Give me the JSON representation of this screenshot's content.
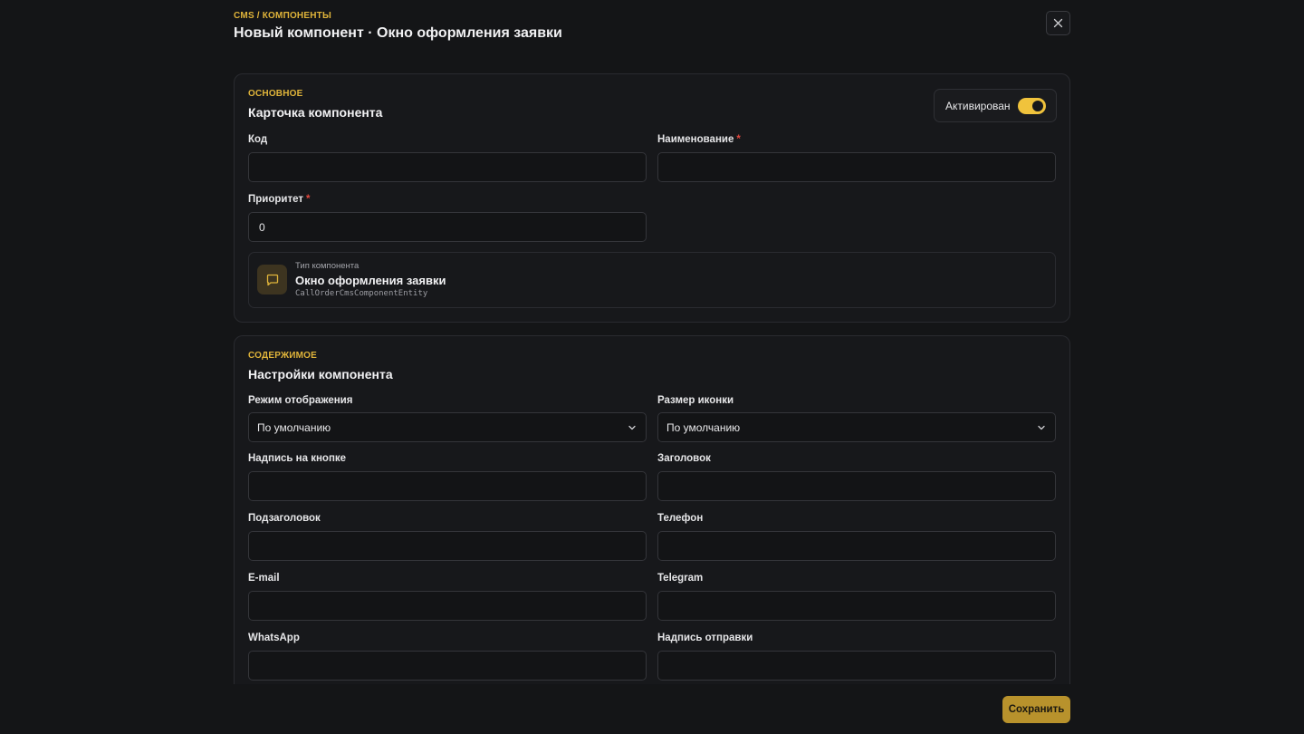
{
  "header": {
    "breadcrumb": "CMS / КОМПОНЕНТЫ",
    "title": "Новый компонент · Окно оформления заявки",
    "close_icon": "close-icon"
  },
  "basic": {
    "eyebrow": "ОСНОВНОЕ",
    "title": "Карточка компонента",
    "active_label": "Активирован",
    "active_on": true,
    "fields": {
      "code": {
        "label": "Код",
        "value": ""
      },
      "name": {
        "label": "Наименование",
        "required": "*",
        "value": ""
      },
      "priority": {
        "label": "Приоритет",
        "required": "*",
        "value": "0"
      }
    },
    "type": {
      "caption": "Тип компонента",
      "name": "Окно оформления заявки",
      "entity": "CallOrderCmsComponentEntity",
      "icon": "message-square-icon"
    }
  },
  "content": {
    "eyebrow": "СОДЕРЖИМОЕ",
    "title": "Настройки компонента",
    "fields": {
      "display_mode": {
        "label": "Режим отображения",
        "value": "По умолчанию"
      },
      "icon_size": {
        "label": "Размер иконки",
        "value": "По умолчанию"
      },
      "button_text": {
        "label": "Надпись на кнопке",
        "value": ""
      },
      "heading": {
        "label": "Заголовок",
        "value": ""
      },
      "subheading": {
        "label": "Подзаголовок",
        "value": ""
      },
      "phone": {
        "label": "Телефон",
        "value": ""
      },
      "email": {
        "label": "E-mail",
        "value": ""
      },
      "telegram": {
        "label": "Telegram",
        "value": ""
      },
      "whatsapp": {
        "label": "WhatsApp",
        "value": ""
      },
      "submit_text": {
        "label": "Надпись отправки",
        "value": ""
      }
    }
  },
  "footer": {
    "save_label": "Сохранить"
  },
  "colors": {
    "accent": "#e0b43a",
    "toggle": "#f0c33c",
    "required": "#e0473e",
    "background": "#141517"
  }
}
